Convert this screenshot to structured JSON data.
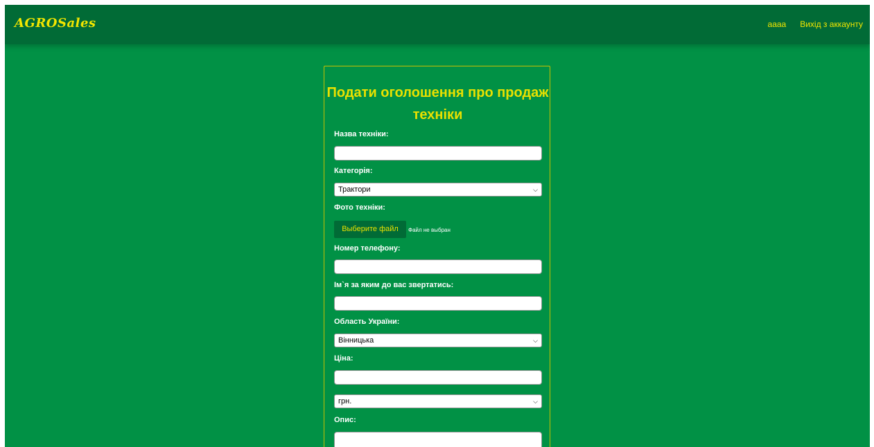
{
  "header": {
    "logo": "AGROSales",
    "username": "aaaa",
    "logout": "Вихід з аккаунту"
  },
  "form": {
    "title": "Подати оголошення про продаж техніки",
    "name_label": "Назва техніки:",
    "name_value": "",
    "category_label": "Категорія:",
    "category_selected": "Трактори",
    "photo_label": "Фото техніки:",
    "file_button": "Выберите файл",
    "file_status": "Файл не выбран",
    "phone_label": "Номер телефону:",
    "phone_value": "",
    "contact_name_label": "Ім`я за яким до вас звертатись:",
    "contact_name_value": "",
    "region_label": "Область України:",
    "region_selected": "Вінницька",
    "price_label": "Ціна:",
    "price_value": "",
    "currency_selected": "грн.",
    "description_label": "Опис:",
    "description_value": ""
  },
  "colors": {
    "background": "#019145",
    "header": "#016b36",
    "accent": "#f3e600"
  }
}
